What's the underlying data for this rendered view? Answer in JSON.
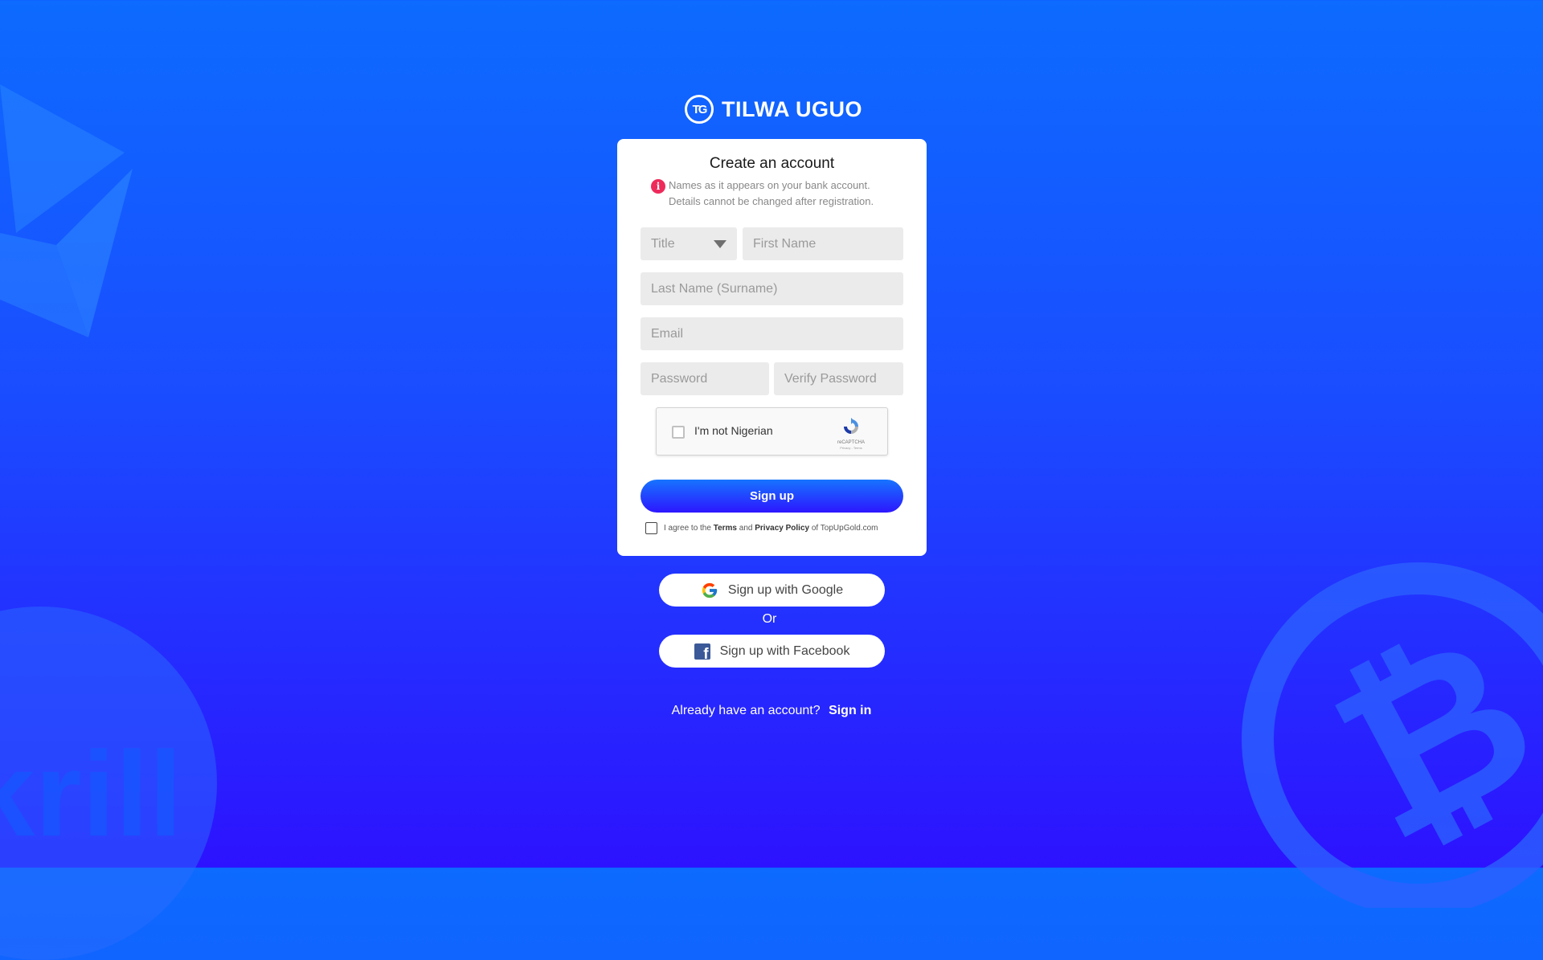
{
  "brand": {
    "logo_mark": "TG",
    "name": "TILWA UGUO"
  },
  "form": {
    "title": "Create an account",
    "notice_line1": "Names as it appears on your bank account.",
    "notice_line2": "Details cannot be changed after registration.",
    "title_select": "Title",
    "first_name_placeholder": "First Name",
    "last_name_placeholder": "Last Name (Surname)",
    "email_placeholder": "Email",
    "password_placeholder": "Password",
    "verify_password_placeholder": "Verify Password",
    "captcha_label": "I'm not Nigerian",
    "captcha_brand": "reCAPTCHA",
    "captcha_links": "Privacy - Terms",
    "signup_label": "Sign up",
    "agree_prefix": "I agree to the",
    "agree_terms": "Terms",
    "agree_and": "and",
    "agree_privacy": "Privacy Policy",
    "agree_suffix": "of TopUpGold.com"
  },
  "social": {
    "google_label": "Sign up with Google",
    "or_label": "Or",
    "facebook_label": "Sign up with Facebook"
  },
  "footer": {
    "prompt": "Already have an account?",
    "signin_label": "Sign in"
  },
  "background_decorations": {
    "ethereum_logo": "ethereum-icon",
    "skrill_logo": "krill",
    "bitcoin_logo": "bitcoin-icon"
  },
  "colors": {
    "bg_top": "#0d6bff",
    "bg_bottom": "#2d12ff",
    "info_icon": "#ee2a5b",
    "facebook": "#3b5998"
  }
}
